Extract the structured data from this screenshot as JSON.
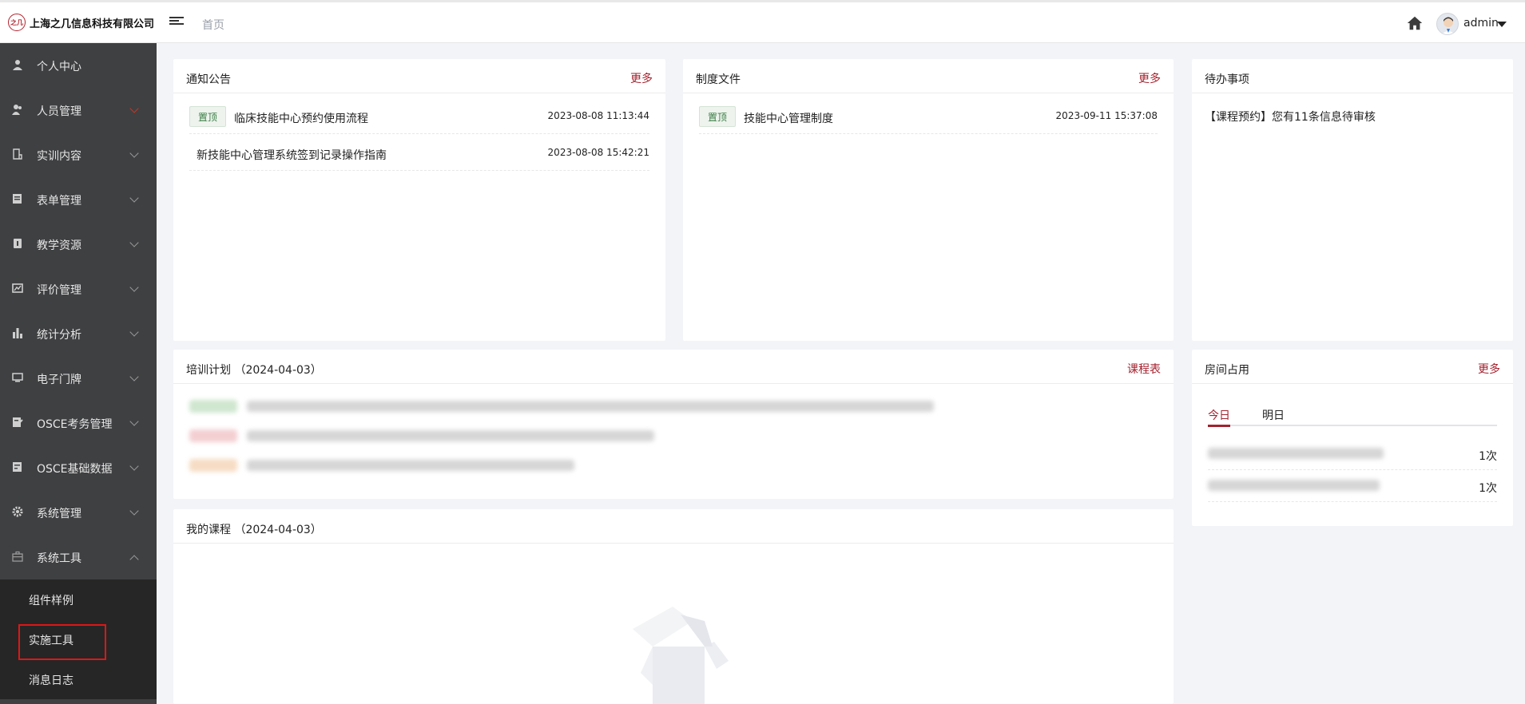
{
  "header": {
    "logo_text": "之几",
    "company": "上海之几信息科技有限公司",
    "breadcrumb": "首页",
    "user": "admin"
  },
  "sidebar": {
    "items": [
      {
        "label": "个人中心",
        "icon": "user-icon"
      },
      {
        "label": "人员管理",
        "icon": "users-icon"
      },
      {
        "label": "实训内容",
        "icon": "training-icon"
      },
      {
        "label": "表单管理",
        "icon": "form-icon"
      },
      {
        "label": "教学资源",
        "icon": "resource-icon"
      },
      {
        "label": "评价管理",
        "icon": "evaluation-icon"
      },
      {
        "label": "统计分析",
        "icon": "bar-chart-icon"
      },
      {
        "label": "电子门牌",
        "icon": "monitor-icon"
      },
      {
        "label": "OSCE考务管理",
        "icon": "exam-icon"
      },
      {
        "label": "OSCE基础数据",
        "icon": "database-icon"
      },
      {
        "label": "系统管理",
        "icon": "gear-icon"
      },
      {
        "label": "系统工具",
        "icon": "toolbox-icon"
      }
    ],
    "subitems": [
      {
        "label": "组件样例"
      },
      {
        "label": "实施工具"
      },
      {
        "label": "消息日志"
      }
    ]
  },
  "notice": {
    "title": "通知公告",
    "more": "更多",
    "rows": [
      {
        "tag": "置顶",
        "title": "临床技能中心预约使用流程",
        "date": "2023-08-08 11:13:44"
      },
      {
        "tag": "",
        "title": "新技能中心管理系统签到记录操作指南",
        "date": "2023-08-08 15:42:21"
      }
    ]
  },
  "policy": {
    "title": "制度文件",
    "more": "更多",
    "rows": [
      {
        "tag": "置顶",
        "title": "技能中心管理制度",
        "date": "2023-09-11 15:37:08"
      }
    ]
  },
  "todo": {
    "title": "待办事项",
    "text": "【课程预约】您有11条信息待审核"
  },
  "plan": {
    "title": "培训计划 （2024-04-03）",
    "link": "课程表"
  },
  "room": {
    "title": "房间占用",
    "more": "更多",
    "tabs": [
      "今日",
      "明日"
    ],
    "rows": [
      {
        "count": "1次"
      },
      {
        "count": "1次"
      }
    ]
  },
  "course": {
    "title": "我的课程 （2024-04-03）"
  },
  "colors": {
    "accent": "#a3222e",
    "sidebar": "#3f4042",
    "submenu": "#262626",
    "highlight_box": "#e01616"
  }
}
